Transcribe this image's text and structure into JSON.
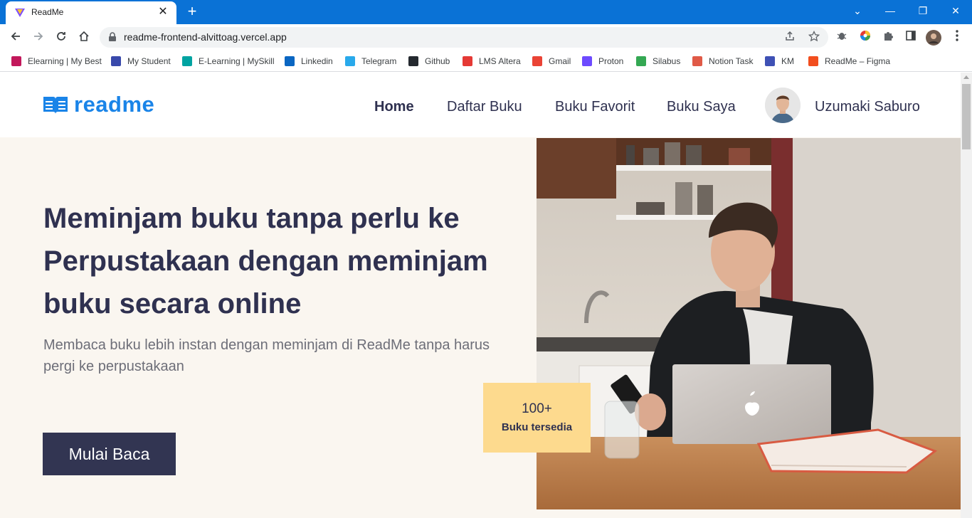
{
  "browser": {
    "tab_title": "ReadMe",
    "tab_close": "✕",
    "new_tab": "+",
    "url": "readme-frontend-alvittoag.vercel.app",
    "window_controls": {
      "chevron": "⌄",
      "minimize": "—",
      "restore": "❐",
      "close": "✕"
    },
    "bookmarks": [
      {
        "label": "Elearning | My Best",
        "icon": "myb-icon",
        "color": "#c2185b"
      },
      {
        "label": "My Student",
        "icon": "student-icon",
        "color": "#3949ab"
      },
      {
        "label": "E-Learning | MySkill",
        "icon": "myskill-icon",
        "color": "#00a3a1"
      },
      {
        "label": "Linkedin",
        "icon": "linkedin-icon",
        "color": "#0a66c2"
      },
      {
        "label": "Telegram",
        "icon": "telegram-icon",
        "color": "#29a9eb"
      },
      {
        "label": "Github",
        "icon": "github-icon",
        "color": "#24292f"
      },
      {
        "label": "LMS Altera",
        "icon": "altera-icon",
        "color": "#e53935"
      },
      {
        "label": "Gmail",
        "icon": "gmail-icon",
        "color": "#ea4335"
      },
      {
        "label": "Proton",
        "icon": "proton-icon",
        "color": "#6d4aff"
      },
      {
        "label": "Silabus",
        "icon": "drive-icon",
        "color": "#34a853"
      },
      {
        "label": "Notion Task",
        "icon": "notion-icon",
        "color": "#e05a47"
      },
      {
        "label": "KM",
        "icon": "km-icon",
        "color": "#3f51b5"
      },
      {
        "label": "ReadMe – Figma",
        "icon": "figma-icon",
        "color": "#f24e1e"
      }
    ]
  },
  "site": {
    "logo_text": "readme",
    "nav": [
      "Home",
      "Daftar Buku",
      "Buku Favorit",
      "Buku Saya"
    ],
    "user_name": "Uzumaki Saburo",
    "hero_title": "Meminjam buku tanpa perlu ke Perpustakaan dengan meminjam buku secara online",
    "hero_subtitle": "Membaca buku lebih instan dengan meminjam di ReadMe tanpa harus pergi ke perpustakaan",
    "cta_label": "Mulai Baca",
    "stat_number": "100+",
    "stat_label": "Buku tersedia"
  },
  "colors": {
    "accent": "#1a84e8",
    "dark": "#323552",
    "hero_bg": "#faf6f0",
    "stat_bg": "#fdda8e",
    "browser_blue": "#0a72d6"
  }
}
